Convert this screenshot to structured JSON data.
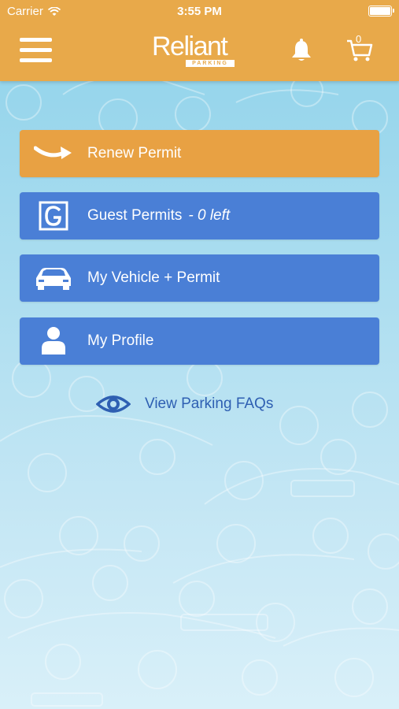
{
  "status_bar": {
    "carrier": "Carrier",
    "time": "3:55 PM"
  },
  "header": {
    "logo_text": "Reliant",
    "logo_subtext": "PARKING",
    "cart_count": "0"
  },
  "menu": {
    "items": [
      {
        "label": "Renew Permit",
        "icon": "arrow-curve-icon",
        "color": "#e8a143"
      },
      {
        "label": "Guest Permits",
        "suffix": "- 0 left",
        "icon": "guest-g-icon",
        "color": "#4a7fd6"
      },
      {
        "label": "My Vehicle + Permit",
        "icon": "car-icon",
        "color": "#4a7fd6"
      },
      {
        "label": "My Profile",
        "icon": "person-icon",
        "color": "#4a7fd6"
      }
    ]
  },
  "faq": {
    "label": "View Parking FAQs",
    "icon": "eye-icon"
  },
  "colors": {
    "header": "#e8a94a",
    "accent_blue": "#4a7fd6",
    "link_blue": "#2e5fb2"
  }
}
